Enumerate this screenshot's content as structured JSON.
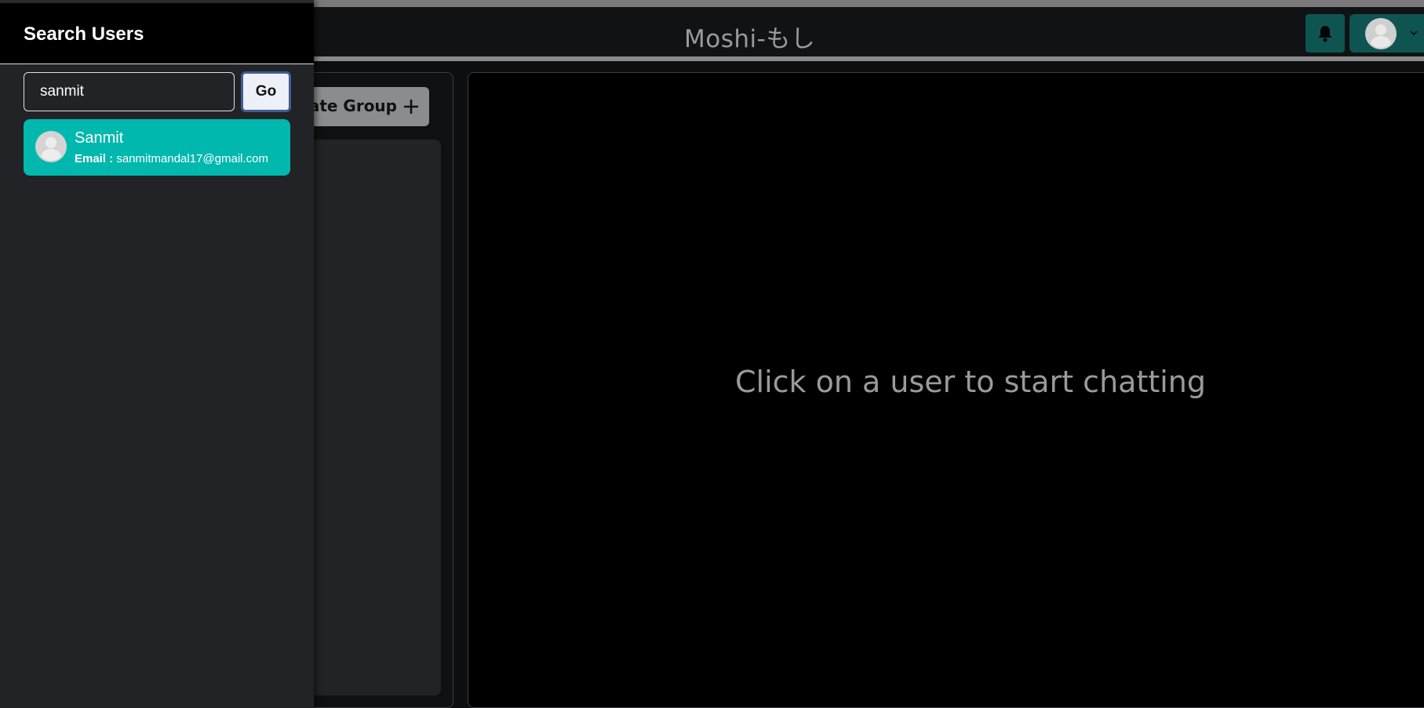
{
  "header": {
    "title": "Moshi-もし",
    "notification_icon": "bell-icon",
    "profile_icon": "avatar-placeholder-icon",
    "profile_menu_icon": "chevron-down-icon"
  },
  "chats_panel": {
    "create_group_label": "ate Group",
    "create_group_icon": "plus-icon"
  },
  "chat_box": {
    "placeholder": "Click on a user to start chatting"
  },
  "drawer": {
    "title": "Search Users",
    "search_value": "sanmit",
    "go_label": "Go",
    "results": [
      {
        "name": "Sanmit",
        "email_label": "Email :",
        "email": "sanmitmandal17@gmail.com",
        "avatar_icon": "avatar-placeholder-icon"
      }
    ]
  },
  "colors": {
    "accent_teal": "#00b8ad",
    "header_button": "#0e5552",
    "drawer_bg": "#222327",
    "go_border": "#3e5f94"
  }
}
